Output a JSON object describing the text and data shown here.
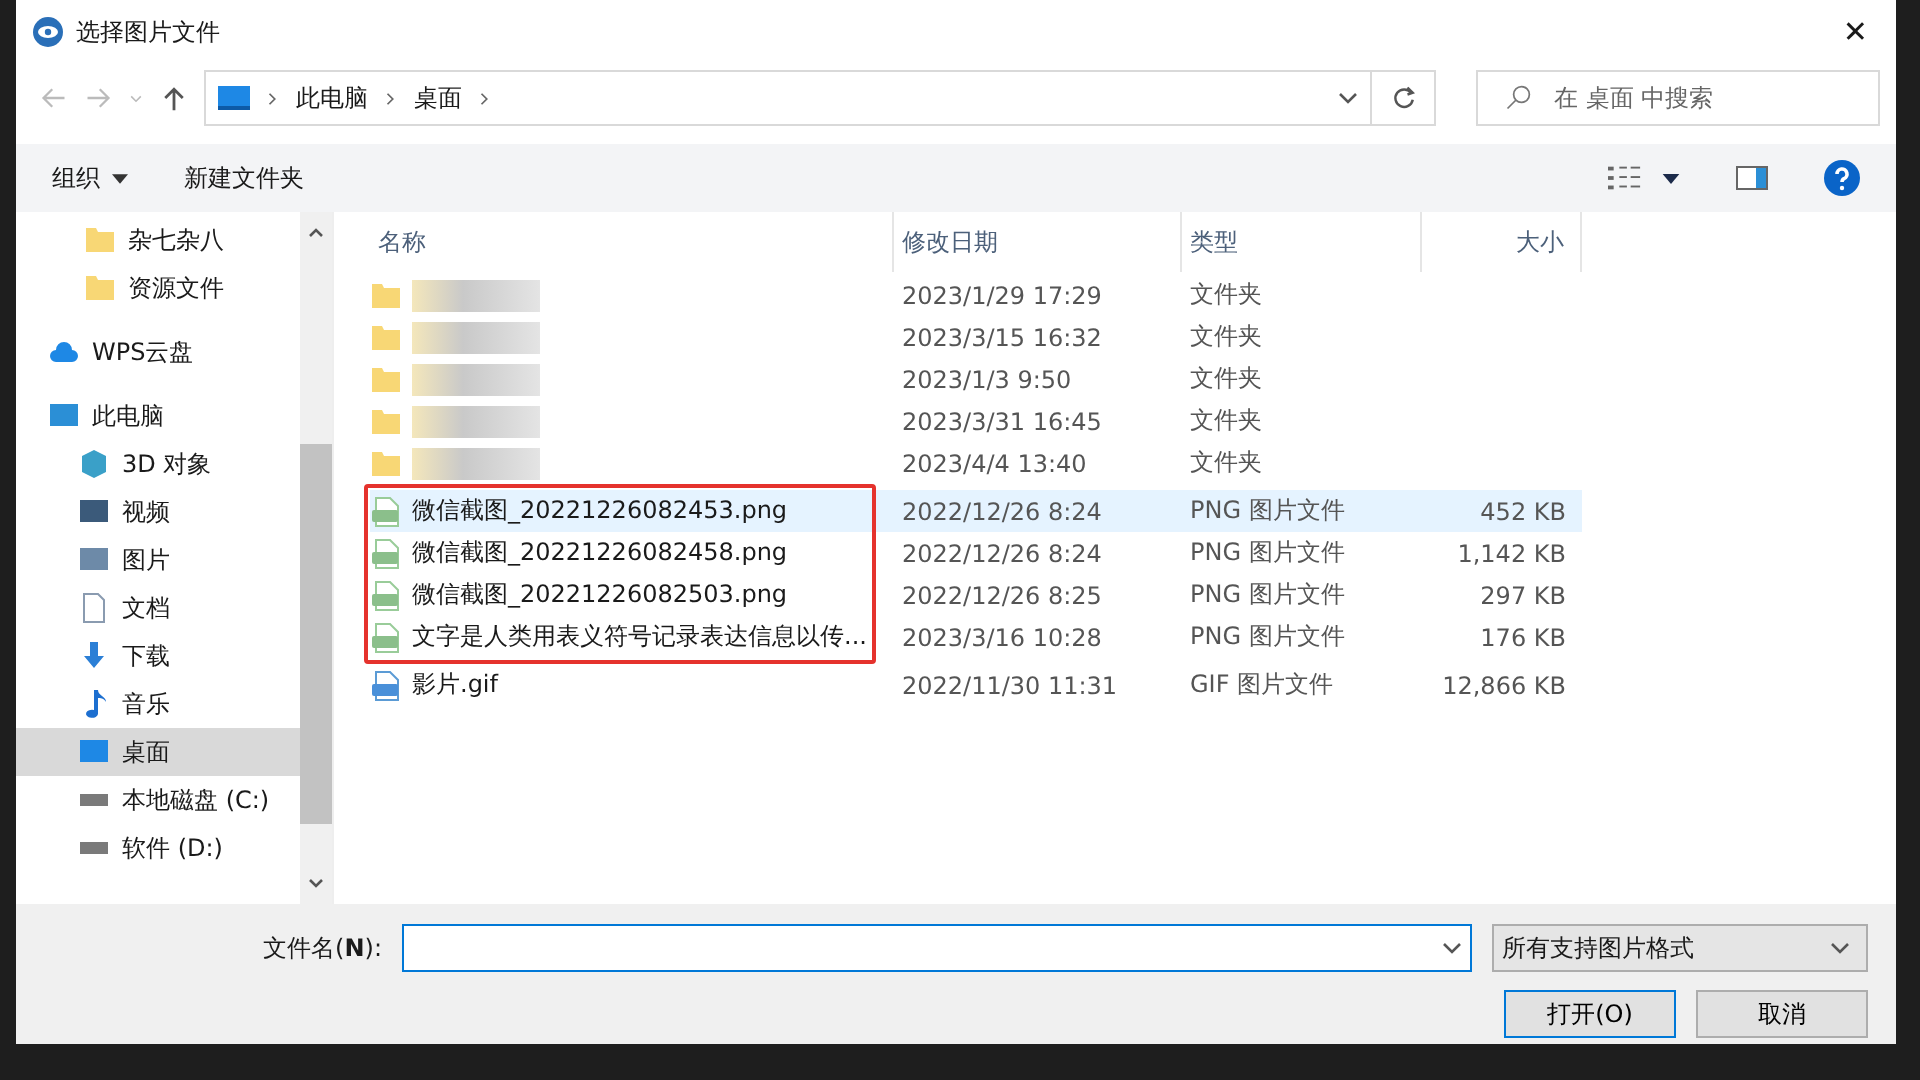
{
  "window": {
    "title": "选择图片文件",
    "close": "✕"
  },
  "address": {
    "path": [
      "此电脑",
      "桌面"
    ],
    "search_placeholder": "在 桌面 中搜索"
  },
  "toolbar": {
    "organize": "组织",
    "new_folder": "新建文件夹"
  },
  "sidebar": {
    "items": [
      {
        "label": "杂七杂八",
        "kind": "folder",
        "selected": false
      },
      {
        "label": "资源文件",
        "kind": "folder",
        "selected": false
      },
      {
        "label": "WPS云盘",
        "kind": "cloud",
        "selected": false
      },
      {
        "label": "此电脑",
        "kind": "pc",
        "selected": false,
        "children": [
          {
            "label": "3D 对象",
            "kind": "cube",
            "selected": false
          },
          {
            "label": "视频",
            "kind": "video",
            "selected": false
          },
          {
            "label": "图片",
            "kind": "image",
            "selected": false
          },
          {
            "label": "文档",
            "kind": "doc",
            "selected": false
          },
          {
            "label": "下载",
            "kind": "download",
            "selected": false
          },
          {
            "label": "音乐",
            "kind": "music",
            "selected": false
          },
          {
            "label": "桌面",
            "kind": "desktop",
            "selected": true
          },
          {
            "label": "本地磁盘 (C:)",
            "kind": "drive",
            "selected": false
          },
          {
            "label": "软件 (D:)",
            "kind": "drive",
            "selected": false
          }
        ]
      }
    ]
  },
  "table": {
    "columns": [
      "名称",
      "修改日期",
      "类型",
      "大小"
    ],
    "rows": [
      {
        "kind": "folder",
        "name_blurred": true,
        "date": "2023/1/29 17:29",
        "type": "文件夹",
        "selected": false,
        "in_red_box": false
      },
      {
        "kind": "folder",
        "name_blurred": true,
        "date": "2023/3/15 16:32",
        "type": "文件夹",
        "selected": false,
        "in_red_box": false
      },
      {
        "kind": "folder",
        "name_blurred": true,
        "date": "2023/1/3 9:50",
        "type": "文件夹",
        "selected": false,
        "in_red_box": false
      },
      {
        "kind": "folder",
        "name_blurred": true,
        "date": "2023/3/31 16:45",
        "type": "文件夹",
        "selected": false,
        "in_red_box": false
      },
      {
        "kind": "folder",
        "name_blurred": true,
        "date": "2023/4/4 13:40",
        "type": "文件夹",
        "selected": false,
        "in_red_box": false
      },
      {
        "kind": "png",
        "name": "微信截图_20221226082453.png",
        "date": "2022/12/26 8:24",
        "type": "PNG 图片文件",
        "size": "452 KB",
        "selected": true,
        "in_red_box": true
      },
      {
        "kind": "png",
        "name": "微信截图_20221226082458.png",
        "date": "2022/12/26 8:24",
        "type": "PNG 图片文件",
        "size": "1,142 KB",
        "selected": false,
        "in_red_box": true
      },
      {
        "kind": "png",
        "name": "微信截图_20221226082503.png",
        "date": "2022/12/26 8:25",
        "type": "PNG 图片文件",
        "size": "297 KB",
        "selected": false,
        "in_red_box": true
      },
      {
        "kind": "png",
        "name": "文字是人类用表义符号记录表达信息以传...",
        "date": "2023/3/16 10:28",
        "type": "PNG 图片文件",
        "size": "176 KB",
        "selected": false,
        "in_red_box": true
      },
      {
        "kind": "gif",
        "name": "影片.gif",
        "date": "2022/11/30 11:31",
        "type": "GIF 图片文件",
        "size": "12,866 KB",
        "selected": false,
        "in_red_box": false
      }
    ]
  },
  "footer": {
    "filename_label": "文件名(**N**):",
    "filter": "所有支持图片格式",
    "buttons": [
      "打开(O)",
      "取消"
    ]
  }
}
